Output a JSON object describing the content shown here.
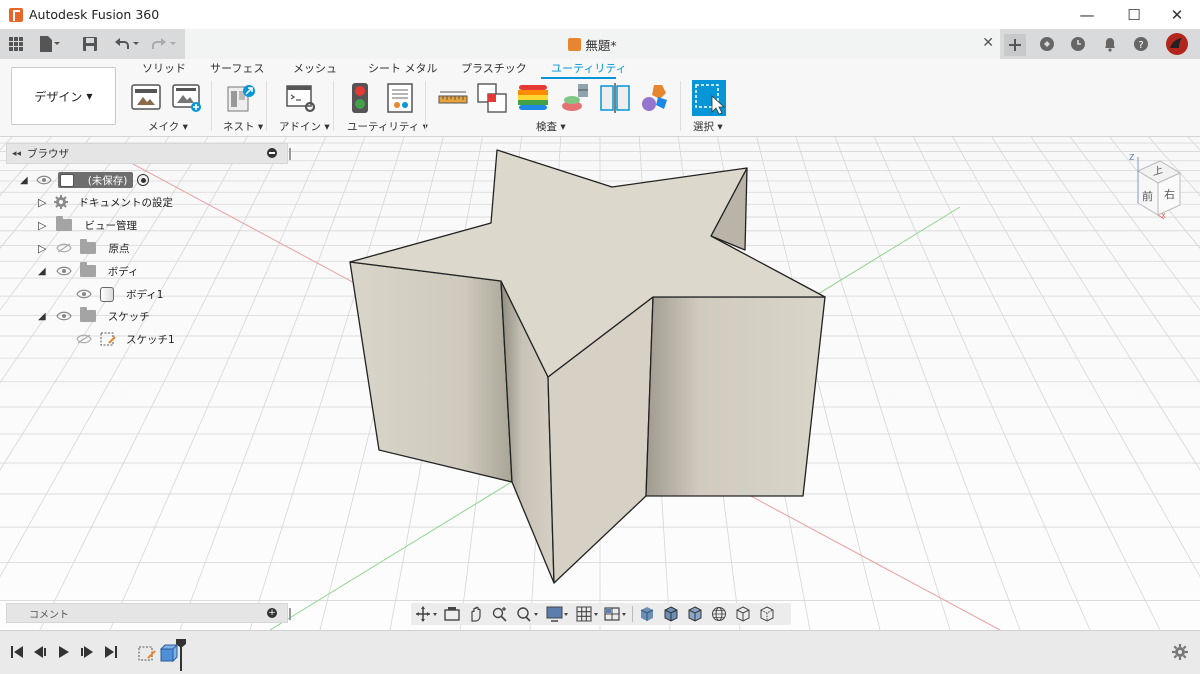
{
  "window": {
    "title": "Autodesk Fusion 360",
    "minimize": "—",
    "maximize": "☐",
    "close": "✕"
  },
  "document": {
    "tab_title": "無題*",
    "tab_close": "✕"
  },
  "ribbon": {
    "workspace": "デザイン",
    "tabs": [
      "ソリッド",
      "サーフェス",
      "メッシュ",
      "シート メタル",
      "プラスチック",
      "ユーティリティ"
    ],
    "active_tab": "ユーティリティ",
    "groups": {
      "make": "メイク",
      "nest": "ネスト",
      "addins": "アドイン",
      "utility": "ユーティリティ",
      "inspect": "検査",
      "select": "選択"
    }
  },
  "browser": {
    "title": "ブラウザ",
    "root_label": "(未保存)",
    "items": [
      {
        "label": "ドキュメントの設定"
      },
      {
        "label": "ビュー管理"
      },
      {
        "label": "原点"
      },
      {
        "label": "ボディ"
      },
      {
        "label": "ボディ1"
      },
      {
        "label": "スケッチ"
      },
      {
        "label": "スケッチ1"
      }
    ]
  },
  "comments": {
    "title": "コメント"
  },
  "viewcube": {
    "front": "前",
    "right": "右",
    "top": "上",
    "axis_z": "Z",
    "axis_x": "X"
  },
  "colors": {
    "accent": "#0696d7",
    "model_face": "#ddd8cc",
    "grid_red": "#e8a0a0",
    "grid_green": "#8fd48f"
  }
}
